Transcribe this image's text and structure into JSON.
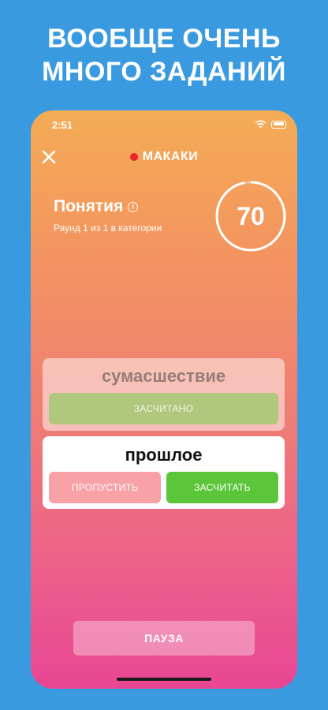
{
  "promo": {
    "headline_line1": "ВООБЩЕ ОЧЕНЬ",
    "headline_line2": "МНОГО ЗАДАНИЙ",
    "background_color": "#3a9ae0"
  },
  "status_bar": {
    "time": "2:51",
    "icons": [
      "wifi-icon",
      "battery-icon"
    ]
  },
  "header": {
    "close_icon": "close-icon",
    "team_name": "МАКАКИ",
    "team_color": "#e8262e"
  },
  "round": {
    "category": "Понятия",
    "info_icon": "i",
    "subtitle": "Раунд 1 из 1 в категории",
    "timer_value": "70",
    "timer_progress": 0.97
  },
  "cards": {
    "done": {
      "word": "сумасшествие",
      "status_label": "ЗАСЧИТАНО"
    },
    "active": {
      "word": "прошлое",
      "skip_label": "ПРОПУСТИТЬ",
      "accept_label": "ЗАСЧИТАТЬ"
    }
  },
  "controls": {
    "pause_label": "ПАУЗА"
  },
  "colors": {
    "gradient_top": "#f4ac55",
    "gradient_bottom": "#e84693",
    "accept": "#5cc63b",
    "skip": "#f8a2a7",
    "done": "#b1c77e"
  }
}
